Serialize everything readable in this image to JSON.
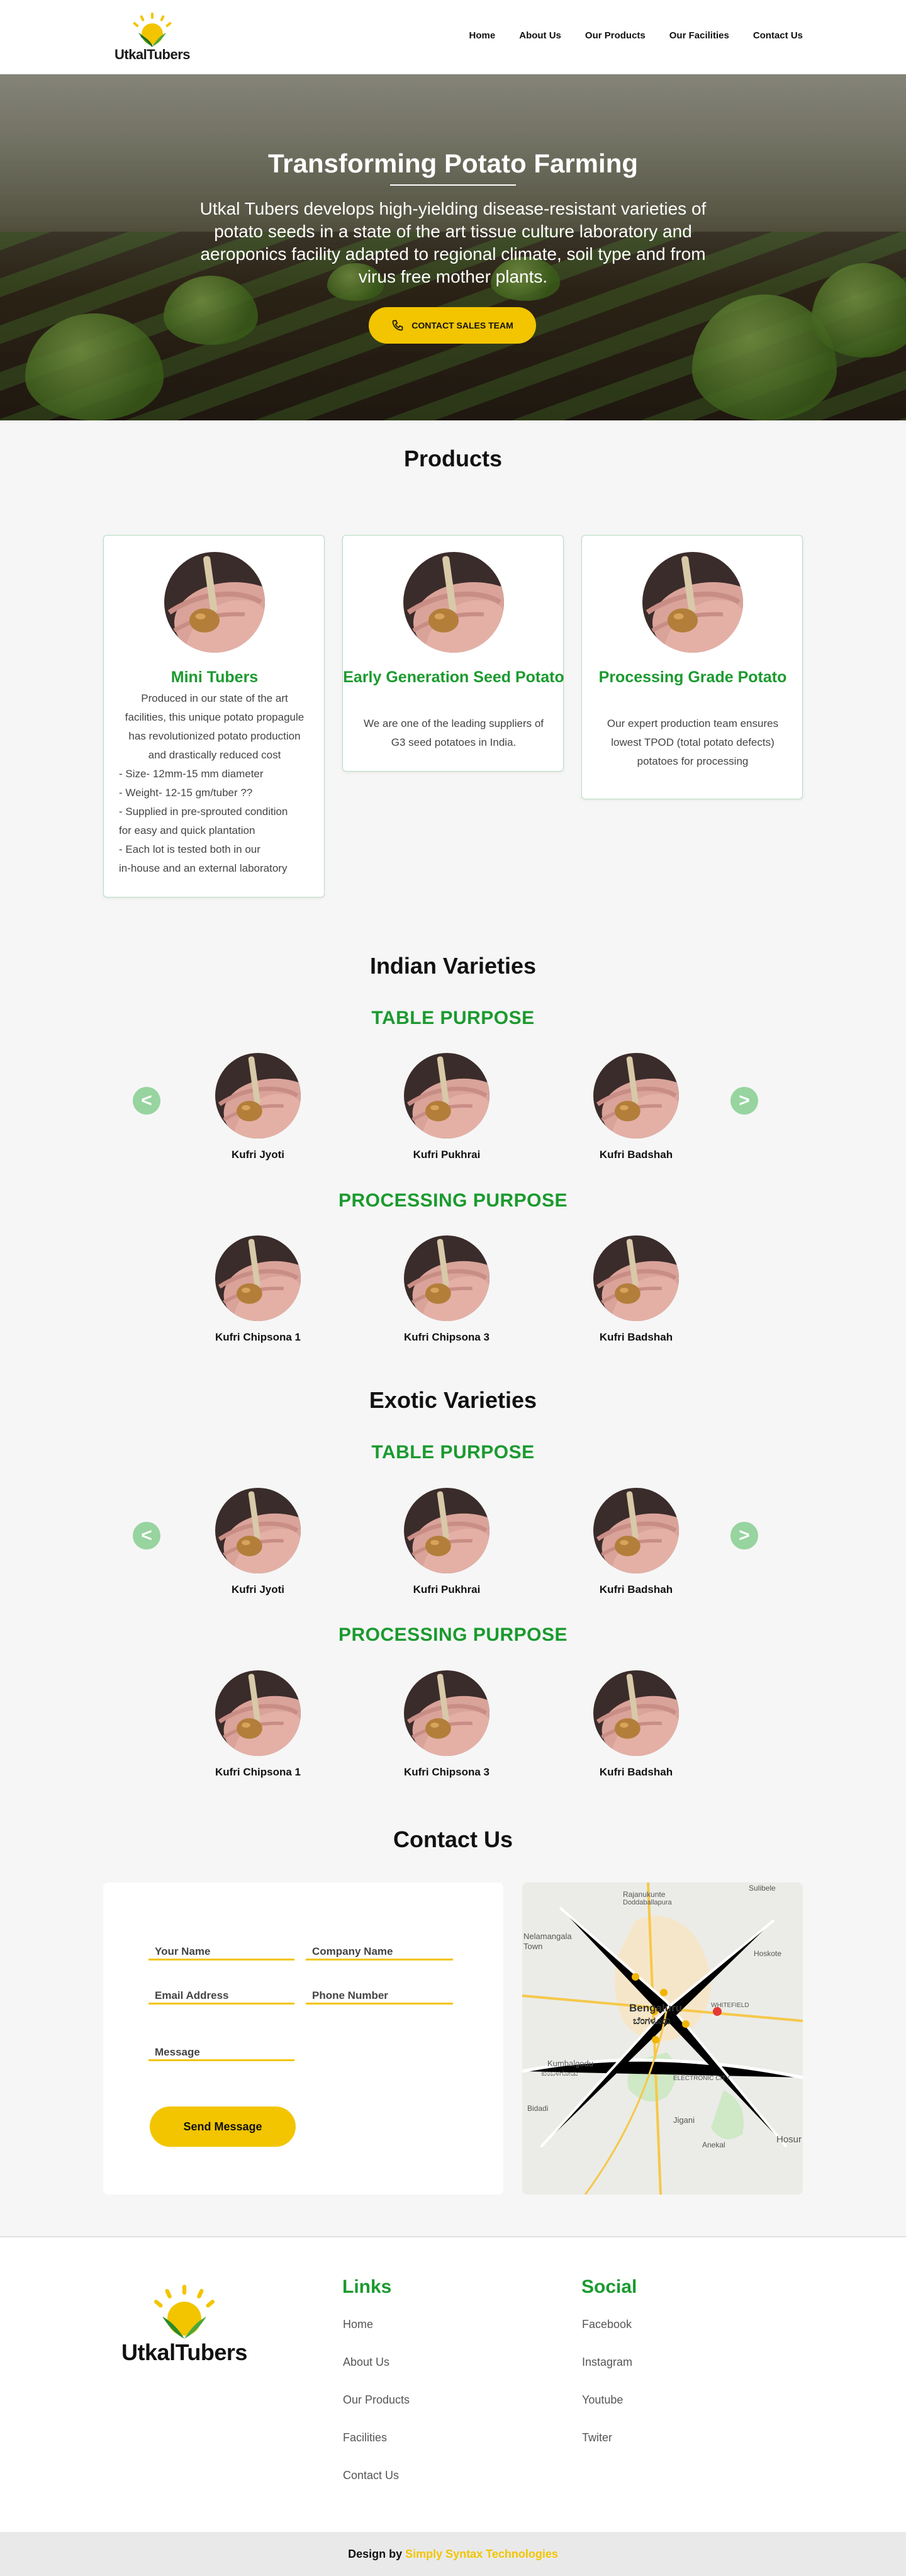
{
  "header": {
    "logo_text": "UtkalTubers",
    "nav": [
      "Home",
      "About Us",
      "Our Products",
      "Our Facilities",
      "Contact Us"
    ]
  },
  "hero": {
    "title": "Transforming Potato Farming",
    "body": "Utkal Tubers develops high-yielding disease-resistant varieties of potato seeds in a state of the art tissue culture laboratory and aeroponics facility adapted to regional climate, soil type and from virus free mother plants.",
    "cta": "CONTACT SALES TEAM",
    "cta_icon": "phone-icon"
  },
  "products": {
    "title": "Products",
    "cards": [
      {
        "title": "Mini Tubers",
        "lines": [
          "Produced in our state of the art",
          "facilities, this unique potato propagule",
          "has revolutionized potato production",
          "and drastically reduced cost",
          "- Size- 12mm-15 mm diameter",
          "- Weight- 12-15 gm/tuber ??",
          "- Supplied in pre-sprouted condition",
          "for easy and quick plantation",
          "- Each lot is tested both in our",
          "in-house and an external laboratory"
        ]
      },
      {
        "title": "Early Generation Seed Potato",
        "lines": [
          "We are one of the leading suppliers of",
          "G3 seed potatoes in India."
        ]
      },
      {
        "title": "Processing Grade Potato",
        "lines": [
          "Our expert production team ensures",
          "lowest TPOD (total potato defects)",
          "potatoes for processing"
        ]
      }
    ]
  },
  "indian": {
    "title": "Indian Varieties",
    "table_title": "TABLE PURPOSE",
    "table": [
      "Kufri Jyoti",
      "Kufri Pukhrai",
      "Kufri Badshah"
    ],
    "processing_title": "PROCESSING PURPOSE",
    "processing": [
      "Kufri Chipsona 1",
      "Kufri Chipsona 3",
      "Kufri Badshah"
    ]
  },
  "exotic": {
    "title": "Exotic Varieties",
    "table_title": "TABLE PURPOSE",
    "table": [
      "Kufri Jyoti",
      "Kufri Pukhrai",
      "Kufri Badshah"
    ],
    "processing_title": "PROCESSING PURPOSE",
    "processing": [
      "Kufri Chipsona 1",
      "Kufri Chipsona 3",
      "Kufri Badshah"
    ]
  },
  "arrows": {
    "prev": "<",
    "next": ">"
  },
  "contact": {
    "title": "Contact Us",
    "placeholders": {
      "name": "Your Name",
      "company": "Company Name",
      "email": "Email Address",
      "phone": "Phone Number",
      "message": "Message"
    },
    "send": "Send Message"
  },
  "map": {
    "labels": [
      "Rajanukunte",
      "Doddaballapura",
      "Sulibele",
      "Nelamangala Town",
      "Hoskote",
      "Bengaluru",
      "ಬೆಂಗಳೂರು",
      "WHITEFIELD",
      "Kumbalgodu",
      "ಕುಂಬಳಗೋಡು",
      "ELECTRONIC CITY",
      "Jigani",
      "Bidadi",
      "Anekal",
      "Hosur"
    ]
  },
  "footer": {
    "logo_text": "UtkalTubers",
    "links_title": "Links",
    "links": [
      "Home",
      "About Us",
      "Our Products",
      "Facilities",
      "Contact Us"
    ],
    "social_title": "Social",
    "social": [
      "Facebook",
      "Instagram",
      "Youtube",
      "Twiter"
    ],
    "credit_prefix": "Design by",
    "credit_brand": "Simply Syntax Technologies"
  },
  "colors": {
    "accent_yellow": "#f2c500",
    "brand_green": "#1b9a2f",
    "arrow_green": "#97d49f"
  }
}
